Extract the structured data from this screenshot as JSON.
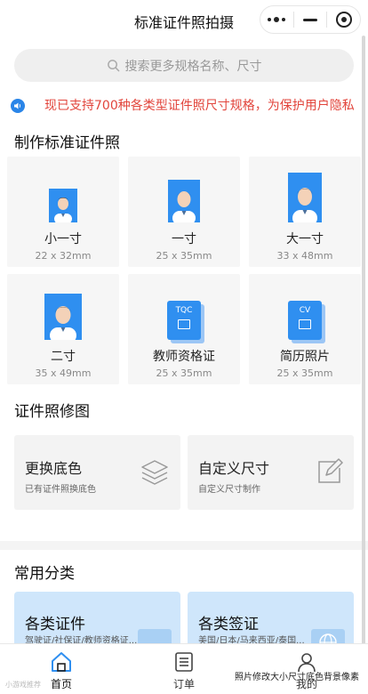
{
  "navbar": {
    "title": "标准证件照拍摄"
  },
  "search": {
    "placeholder": "搜索更多规格名称、尺寸"
  },
  "notice": {
    "text": "现已支持700种各类型证件照尺寸规格，为保护用户隐私"
  },
  "sections": {
    "make": "制作标准证件照",
    "retouch": "证件照修图",
    "categories": "常用分类"
  },
  "sizes": [
    {
      "name": "小一寸",
      "size": "22 x 32mm",
      "icon": "portrait"
    },
    {
      "name": "一寸",
      "size": "25 x 35mm",
      "icon": "portrait"
    },
    {
      "name": "大一寸",
      "size": "33 x 48mm",
      "icon": "portrait"
    },
    {
      "name": "二寸",
      "size": "35 x 49mm",
      "icon": "portrait"
    },
    {
      "name": "教师资格证",
      "size": "25 x 35mm",
      "icon": "tqc-doc",
      "badge": "TQC"
    },
    {
      "name": "简历照片",
      "size": "25 x 35mm",
      "icon": "cv-doc",
      "badge": "CV"
    }
  ],
  "tools": [
    {
      "title": "更换底色",
      "sub": "已有证件照换底色",
      "icon": "layers-icon"
    },
    {
      "title": "自定义尺寸",
      "sub": "自定义尺寸制作",
      "icon": "edit-icon"
    }
  ],
  "categories": [
    {
      "title": "各类证件",
      "sub": "驾驶证/社保证/教师资格证..."
    },
    {
      "title": "各类签证",
      "sub": "美国/日本/马来西亚/泰国..."
    }
  ],
  "tabs": [
    {
      "label": "首页",
      "icon": "home-icon",
      "active": true
    },
    {
      "label": "订单",
      "icon": "list-icon",
      "active": false
    },
    {
      "label": "我的",
      "icon": "user-icon",
      "active": false
    }
  ],
  "watermark": {
    "text": "照片修改大小尺寸底色背景像素",
    "left": "小游戏推荐"
  },
  "colors": {
    "accent": "#2f8ff0",
    "notice": "#e2453c",
    "card": "#f6f6f6",
    "category": "#cfe6fb"
  }
}
